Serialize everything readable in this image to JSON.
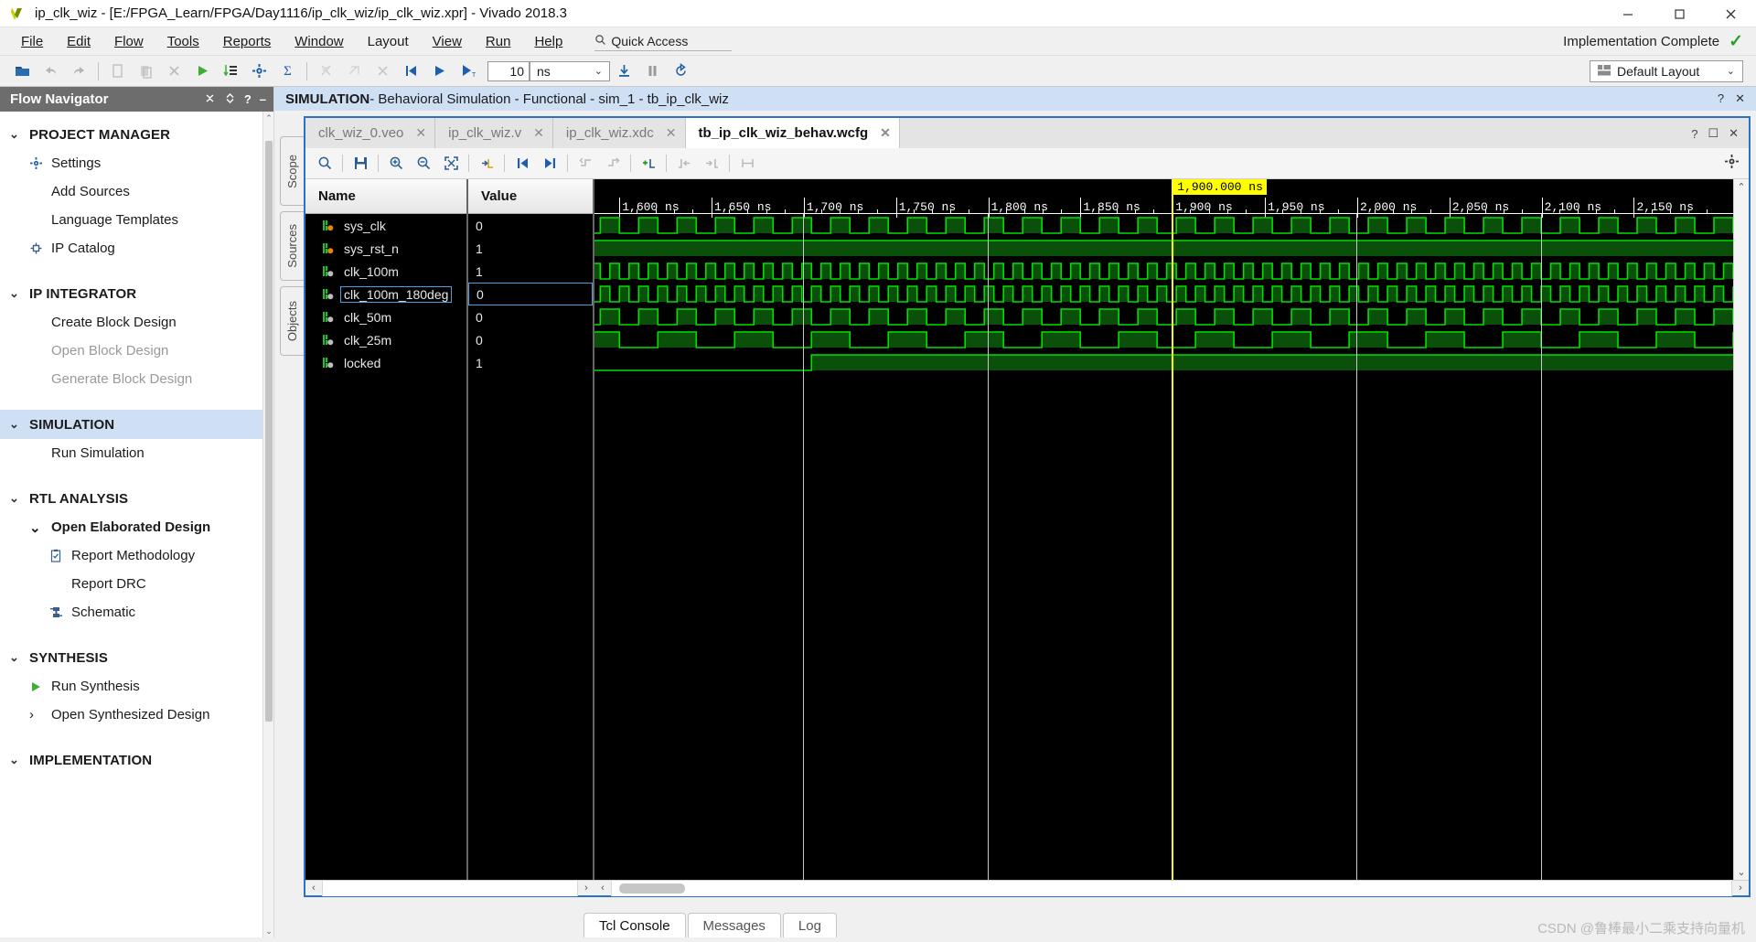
{
  "window": {
    "title": "ip_clk_wiz - [E:/FPGA_Learn/FPGA/Day1116/ip_clk_wiz/ip_clk_wiz.xpr] - Vivado 2018.3",
    "minimize": "─",
    "maximize": "❑",
    "close": "✕"
  },
  "menu": {
    "items": [
      "File",
      "Edit",
      "Flow",
      "Tools",
      "Reports",
      "Window",
      "Layout",
      "View",
      "Run",
      "Help"
    ],
    "quick_access_placeholder": "Quick Access",
    "search_icon": "search-icon"
  },
  "status": {
    "implementation": "Implementation Complete",
    "check": "✓",
    "check_color": "#2aa12a"
  },
  "toolbar": {
    "time_value": "10",
    "time_unit": "ns",
    "layout_label": "Default Layout",
    "chevron": "⌄"
  },
  "flow_navigator": {
    "title": "Flow Navigator",
    "groups": [
      {
        "label": "PROJECT MANAGER",
        "active": false,
        "items": [
          {
            "label": "Settings",
            "icon": "gear-icon",
            "dim": false
          },
          {
            "label": "Add Sources",
            "icon": "",
            "dim": false
          },
          {
            "label": "Language Templates",
            "icon": "",
            "dim": false
          },
          {
            "label": "IP Catalog",
            "icon": "ip-catalog-icon",
            "dim": false
          }
        ]
      },
      {
        "label": "IP INTEGRATOR",
        "active": false,
        "items": [
          {
            "label": "Create Block Design",
            "icon": "",
            "dim": false
          },
          {
            "label": "Open Block Design",
            "icon": "",
            "dim": true
          },
          {
            "label": "Generate Block Design",
            "icon": "",
            "dim": true
          }
        ]
      },
      {
        "label": "SIMULATION",
        "active": true,
        "items": [
          {
            "label": "Run Simulation",
            "icon": "",
            "dim": false
          }
        ]
      },
      {
        "label": "RTL ANALYSIS",
        "active": false,
        "items": [
          {
            "label": "Open Elaborated Design",
            "icon": "chevron-down-icon",
            "dim": false,
            "bold": true
          },
          {
            "label": "Report Methodology",
            "icon": "clipboard-check-icon",
            "dim": false,
            "indent": true
          },
          {
            "label": "Report DRC",
            "icon": "",
            "dim": false,
            "indent": true
          },
          {
            "label": "Schematic",
            "icon": "schematic-icon",
            "dim": false,
            "indent": true
          }
        ]
      },
      {
        "label": "SYNTHESIS",
        "active": false,
        "items": [
          {
            "label": "Run Synthesis",
            "icon": "play-icon",
            "dim": false
          },
          {
            "label": "Open Synthesized Design",
            "icon": "chevron-right-icon",
            "dim": false
          }
        ]
      },
      {
        "label": "IMPLEMENTATION",
        "active": false,
        "items": []
      }
    ]
  },
  "simulation": {
    "banner_bold": "SIMULATION",
    "banner_rest": " - Behavioral Simulation - Functional - sim_1 - tb_ip_clk_wiz",
    "help_icon": "?",
    "close_icon": "✕",
    "vertical_tabs": [
      "Scope",
      "Sources",
      "Objects"
    ],
    "tabs": [
      {
        "label": "clk_wiz_0.veo",
        "active": false,
        "close": "✕"
      },
      {
        "label": "ip_clk_wiz.v",
        "active": false,
        "close": "✕"
      },
      {
        "label": "ip_clk_wiz.xdc",
        "active": false,
        "close": "✕"
      },
      {
        "label": "tb_ip_clk_wiz_behav.wcfg",
        "active": true,
        "close": "✕"
      }
    ],
    "wave_toolbar_icons": [
      "search-icon",
      "save-icon",
      "zoom-in-icon",
      "zoom-out-icon",
      "zoom-fit-icon",
      "snap-to-transition-icon",
      "go-to-start-icon",
      "go-to-end-icon",
      "previous-transition-icon",
      "next-transition-icon",
      "add-marker-icon",
      "previous-marker-icon",
      "next-marker-icon",
      "measure-icon"
    ],
    "settings_icon": "gear-icon"
  },
  "waveform": {
    "name_header": "Name",
    "value_header": "Value",
    "cursor_label": "1,900.000 ns",
    "cursor_time_ns": 1900,
    "cursor_color": "#ffff00",
    "wave_color": "#00e000",
    "wave_fill": "#0a4f0a",
    "time_start_ns": 1587,
    "time_end_ns": 2180,
    "tick_interval_ns": 50,
    "ticks": [
      "1,600 ns",
      "1,650 ns",
      "1,700 ns",
      "1,750 ns",
      "1,800 ns",
      "1,850 ns",
      "1,900 ns",
      "1,950 ns",
      "2,000 ns",
      "2,050 ns",
      "2,100 ns",
      "2,150 ns"
    ],
    "tick_values_ns": [
      1600,
      1650,
      1700,
      1750,
      1800,
      1850,
      1900,
      1950,
      2000,
      2050,
      2100,
      2150
    ],
    "marker_lines_ns": [
      1700,
      1800,
      2000,
      2100
    ],
    "signals": [
      {
        "name": "sys_clk",
        "value": "0",
        "icon": "input-signal-icon",
        "selected": false,
        "kind": "clock",
        "period_ns": 20,
        "duty": 0.5,
        "phase_ns": 0,
        "start_level": 0
      },
      {
        "name": "sys_rst_n",
        "value": "1",
        "icon": "input-signal-icon",
        "selected": false,
        "kind": "const",
        "level": 1
      },
      {
        "name": "clk_100m",
        "value": "1",
        "icon": "output-signal-icon",
        "selected": false,
        "kind": "clock",
        "period_ns": 10,
        "duty": 0.5,
        "phase_ns": 0,
        "start_level": 1
      },
      {
        "name": "clk_100m_180deg",
        "value": "0",
        "icon": "output-signal-icon",
        "selected": true,
        "kind": "clock",
        "period_ns": 10,
        "duty": 0.5,
        "phase_ns": 5,
        "start_level": 0
      },
      {
        "name": "clk_50m",
        "value": "0",
        "icon": "output-signal-icon",
        "selected": false,
        "kind": "clock",
        "period_ns": 20,
        "duty": 0.5,
        "phase_ns": 0,
        "start_level": 0
      },
      {
        "name": "clk_25m",
        "value": "0",
        "icon": "output-signal-icon",
        "selected": false,
        "kind": "clock",
        "period_ns": 40,
        "duty": 0.5,
        "phase_ns": 0,
        "start_level": 1
      },
      {
        "name": "locked",
        "value": "1",
        "icon": "output-signal-icon",
        "selected": false,
        "kind": "step",
        "rise_ns": 1700,
        "start_level": 0
      }
    ],
    "hscroll_left_arrow": "‹",
    "hscroll_right_arrow": "›",
    "vscroll_up_arrow": "⌃",
    "vscroll_down_arrow": "⌄"
  },
  "bottom_tabs": [
    {
      "label": "Tcl Console",
      "active": true
    },
    {
      "label": "Messages",
      "active": false
    },
    {
      "label": "Log",
      "active": false
    }
  ],
  "watermark": {
    "text": "CSDN @鲁棒最小二乘支持向量机"
  }
}
